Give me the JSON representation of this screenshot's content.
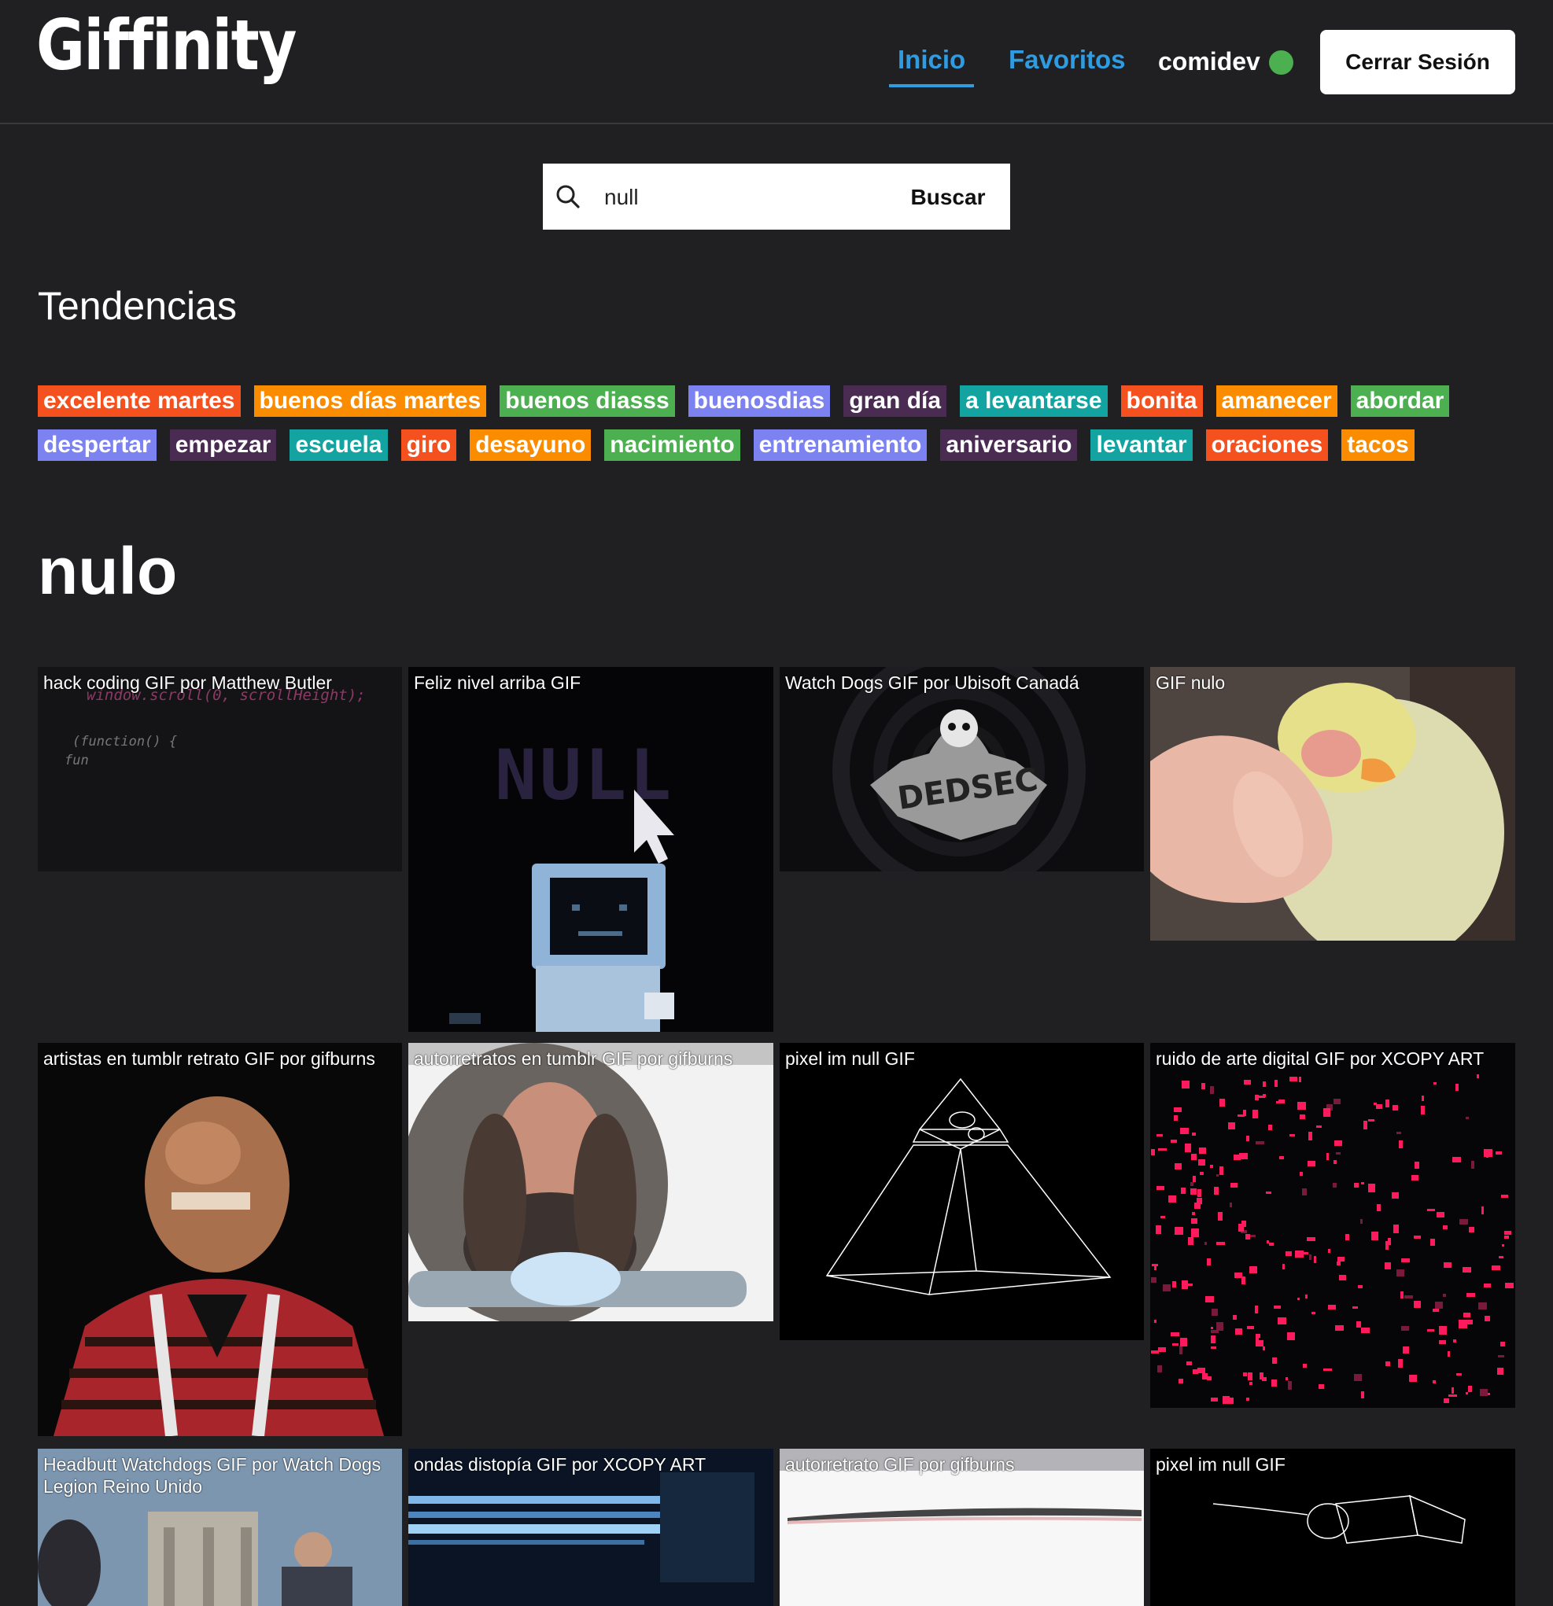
{
  "header": {
    "logo": "Giffinity",
    "nav": {
      "home": "Inicio",
      "favorites": "Favoritos"
    },
    "username": "comidev",
    "logout_label": "Cerrar Sesión"
  },
  "search": {
    "value": "null",
    "button_label": "Buscar"
  },
  "trending": {
    "title": "Tendencias",
    "row1": [
      {
        "label": "excelente martes",
        "color": "#f4511e"
      },
      {
        "label": "buenos días martes",
        "color": "#fb8c00"
      },
      {
        "label": "buenos diasss",
        "color": "#4caf50"
      },
      {
        "label": "buenosdias",
        "color": "#7c83f0"
      },
      {
        "label": "gran día",
        "color": "#4a2b52"
      },
      {
        "label": "a levantarse",
        "color": "#13a3a0"
      },
      {
        "label": "bonita",
        "color": "#f4511e"
      },
      {
        "label": "amanecer",
        "color": "#fb8c00"
      },
      {
        "label": "abordar",
        "color": "#4caf50"
      }
    ],
    "row2": [
      {
        "label": "despertar",
        "color": "#7c83f0"
      },
      {
        "label": "empezar",
        "color": "#4a2b52"
      },
      {
        "label": "escuela",
        "color": "#13a3a0"
      },
      {
        "label": "giro",
        "color": "#f4511e"
      },
      {
        "label": "desayuno",
        "color": "#fb8c00"
      },
      {
        "label": "nacimiento",
        "color": "#4caf50"
      },
      {
        "label": "entrenamiento",
        "color": "#7c83f0"
      },
      {
        "label": "aniversario",
        "color": "#4a2b52"
      },
      {
        "label": "levantar",
        "color": "#13a3a0"
      },
      {
        "label": "oraciones",
        "color": "#f4511e"
      },
      {
        "label": "tacos",
        "color": "#fb8c00"
      }
    ]
  },
  "results": {
    "title": "nulo",
    "gifs": [
      {
        "title": "hack coding GIF por Matthew Butler"
      },
      {
        "title": "Feliz nivel arriba GIF"
      },
      {
        "title": "Watch Dogs GIF por Ubisoft Canadá"
      },
      {
        "title": "GIF nulo"
      },
      {
        "title": "artistas en tumblr retrato GIF por gifburns"
      },
      {
        "title": "autorretratos en tumblr GIF por gifburns"
      },
      {
        "title": "pixel im null GIF"
      },
      {
        "title": "ruido de arte digital GIF por XCOPY ART"
      },
      {
        "title": "Headbutt Watchdogs GIF por Watch Dogs Legion Reino Unido"
      },
      {
        "title": "ondas distopía GIF por XCOPY ART"
      },
      {
        "title": "autorretrato GIF por gifburns"
      },
      {
        "title": "pixel im null GIF"
      }
    ]
  },
  "art_text": {
    "code_line1": "window.scroll(0, scrollHeight);",
    "code_line2": "(function() {",
    "code_line3": "fun",
    "null_word": "NULL",
    "dedsec": "DEDSEC"
  },
  "colors": {
    "accent": "#2f9be0",
    "online": "#4caf50",
    "background": "#202023"
  }
}
